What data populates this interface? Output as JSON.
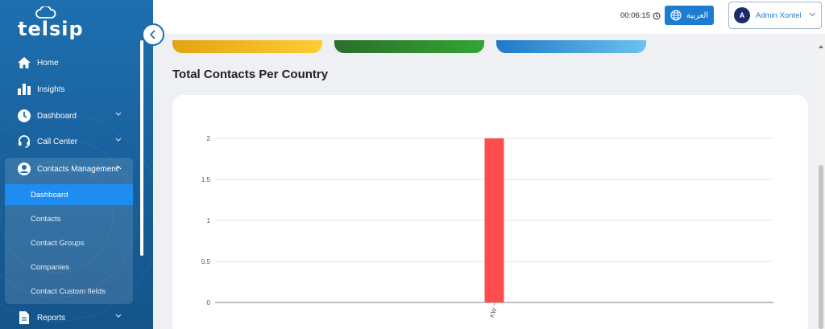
{
  "brand": {
    "name": "telsip"
  },
  "sidebar": {
    "items": [
      {
        "label": "Home",
        "icon": "home-icon"
      },
      {
        "label": "Insights",
        "icon": "bar-chart-icon"
      },
      {
        "label": "Dashboard",
        "icon": "clock-icon"
      },
      {
        "label": "Call Center",
        "icon": "headset-icon"
      },
      {
        "label": "Contacts Management",
        "icon": "user-circle-icon"
      },
      {
        "label": "Reports",
        "icon": "document-icon"
      }
    ],
    "submenu": [
      {
        "label": "Dashboard",
        "active": true
      },
      {
        "label": "Contacts"
      },
      {
        "label": "Contact Groups"
      },
      {
        "label": "Companies"
      },
      {
        "label": "Contact Custom fields"
      }
    ]
  },
  "header": {
    "timer": "00:06:15",
    "language_button": "العربية",
    "user": {
      "initial": "A",
      "name": "Admin Xontel"
    }
  },
  "main": {
    "section_title": "Total Contacts Per Country"
  },
  "colors": {
    "sidebar": "#1e6fb0",
    "accent": "#1d7bd0",
    "bar": "#ff4d4f",
    "card_yellow": "#f2b51b",
    "card_green": "#2e8b2e",
    "card_blue": "#3a9be0"
  },
  "chart_data": {
    "type": "bar",
    "categories": [
      "KW"
    ],
    "values": [
      2
    ],
    "title": "",
    "xlabel": "",
    "ylabel": "",
    "ylim": [
      0,
      2
    ],
    "yticks": [
      "0",
      "0.5",
      "1",
      "1.5",
      "2"
    ],
    "grid": true
  }
}
